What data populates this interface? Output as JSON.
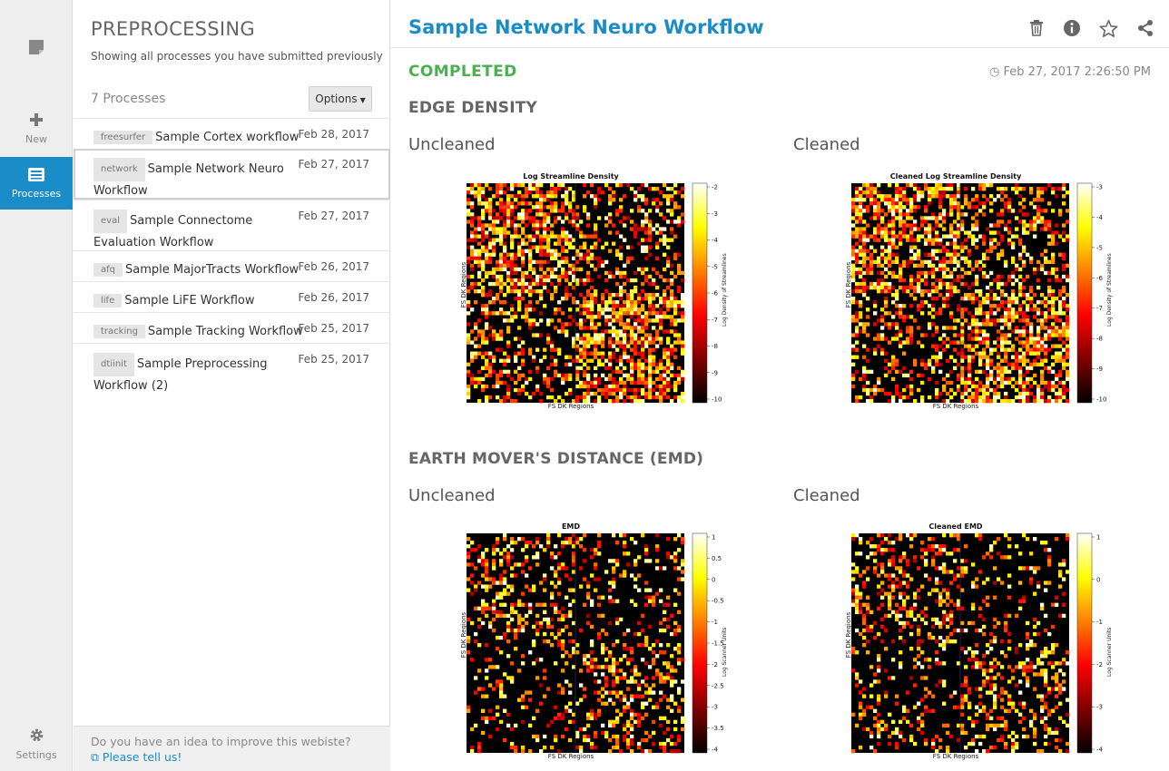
{
  "rail": {
    "new_label": "New",
    "processes_label": "Processes",
    "settings_label": "Settings"
  },
  "list": {
    "title": "PREPROCESSING",
    "subtitle": "Showing all processes you have submitted previously",
    "count": "7 Processes",
    "options_label": "Options",
    "processes": [
      {
        "tag": "freesurfer",
        "name": "Sample Cortex workflow",
        "date": "Feb 28, 2017"
      },
      {
        "tag": "network",
        "name": "Sample Network Neuro Workflow",
        "date": "Feb 27, 2017"
      },
      {
        "tag": "eval",
        "name": "Sample Connectome Evaluation Workflow",
        "date": "Feb 27, 2017"
      },
      {
        "tag": "afq",
        "name": "Sample MajorTracts Workflow",
        "date": "Feb 26, 2017"
      },
      {
        "tag": "life",
        "name": "Sample LiFE Workflow",
        "date": "Feb 26, 2017"
      },
      {
        "tag": "tracking",
        "name": "Sample Tracking Workflow",
        "date": "Feb 25, 2017"
      },
      {
        "tag": "dtiinit",
        "name": "Sample Preprocessing Workflow (2)",
        "date": "Feb 25, 2017"
      }
    ],
    "footer_text": "Do you have an idea to improve this webiste?",
    "footer_link": "Please tell us!"
  },
  "main": {
    "title": "Sample Network Neuro Workflow",
    "status": "COMPLETED",
    "timestamp": "Feb 27, 2017 2:26:50 PM",
    "sections": [
      {
        "heading": "EDGE DENSITY",
        "left_label": "Uncleaned",
        "right_label": "Cleaned"
      },
      {
        "heading": "EARTH MOVER'S DISTANCE (EMD)",
        "left_label": "Uncleaned",
        "right_label": "Cleaned"
      }
    ]
  },
  "colors": {
    "accent": "#1a8cc8",
    "status_green": "#4caf50"
  },
  "chart_data": [
    {
      "type": "heatmap",
      "title": "Log Streamline Density",
      "xlabel": "FS DK Regions",
      "ylabel": "FS DK Regions",
      "colorbar_label": "Log Density of Streamlines",
      "colorbar_ticks": [
        "-2",
        "-3",
        "-4",
        "-5",
        "-6",
        "-7",
        "-8",
        "-9",
        "-10"
      ],
      "colormap": "hot",
      "seed": 11
    },
    {
      "type": "heatmap",
      "title": "Cleaned Log Streamline Density",
      "xlabel": "FS DK Regions",
      "ylabel": "FS DK Regions",
      "colorbar_label": "Log Density of Streamlines",
      "colorbar_ticks": [
        "-3",
        "-4",
        "-5",
        "-6",
        "-7",
        "-8",
        "-9",
        "-10"
      ],
      "colormap": "hot",
      "seed": 23
    },
    {
      "type": "heatmap",
      "title": "EMD",
      "xlabel": "FS DK Regions",
      "ylabel": "FS DK Regions",
      "colorbar_label": "Log Scanner Units",
      "colorbar_ticks": [
        "1",
        "0.5",
        "0",
        "-0.5",
        "-1",
        "-1.5",
        "-2",
        "-2.5",
        "-3",
        "-3.5",
        "-4"
      ],
      "colormap": "hot",
      "seed": 37
    },
    {
      "type": "heatmap",
      "title": "Cleaned EMD",
      "xlabel": "FS DK Regions",
      "ylabel": "FS DK Regions",
      "colorbar_label": "Log Scanner Units",
      "colorbar_ticks": [
        "1",
        "0",
        "-1",
        "-2",
        "-3",
        "-4"
      ],
      "colormap": "hot",
      "seed": 53
    }
  ]
}
